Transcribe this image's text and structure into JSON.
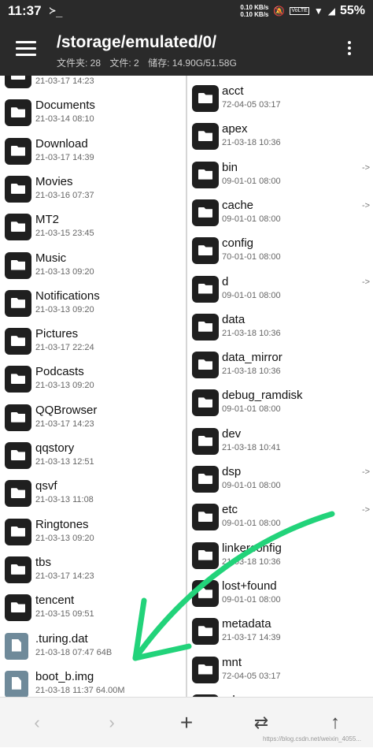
{
  "status": {
    "time": "11:37",
    "term": "≻_",
    "net_up": "0.10 KB/s",
    "net_down": "0.10 KB/s",
    "volte": "VoLTE",
    "battery": "55%"
  },
  "header": {
    "path": "/storage/emulated/0/",
    "folders_label": "文件夹: 28",
    "files_label": "文件: 2",
    "storage_label": "储存: 14.90G/51.58G"
  },
  "left_pane": {
    "items": [
      {
        "name": "",
        "meta": "21-03-17 14:23",
        "type": "folder"
      },
      {
        "name": "Documents",
        "meta": "21-03-14 08:10",
        "type": "folder"
      },
      {
        "name": "Download",
        "meta": "21-03-17 14:39",
        "type": "folder"
      },
      {
        "name": "Movies",
        "meta": "21-03-16 07:37",
        "type": "folder"
      },
      {
        "name": "MT2",
        "meta": "21-03-15 23:45",
        "type": "folder"
      },
      {
        "name": "Music",
        "meta": "21-03-13 09:20",
        "type": "folder"
      },
      {
        "name": "Notifications",
        "meta": "21-03-13 09:20",
        "type": "folder"
      },
      {
        "name": "Pictures",
        "meta": "21-03-17 22:24",
        "type": "folder"
      },
      {
        "name": "Podcasts",
        "meta": "21-03-13 09:20",
        "type": "folder"
      },
      {
        "name": "QQBrowser",
        "meta": "21-03-17 14:23",
        "type": "folder"
      },
      {
        "name": "qqstory",
        "meta": "21-03-13 12:51",
        "type": "folder"
      },
      {
        "name": "qsvf",
        "meta": "21-03-13 11:08",
        "type": "folder"
      },
      {
        "name": "Ringtones",
        "meta": "21-03-13 09:20",
        "type": "folder"
      },
      {
        "name": "tbs",
        "meta": "21-03-17 14:23",
        "type": "folder"
      },
      {
        "name": "tencent",
        "meta": "21-03-15 09:51",
        "type": "folder"
      },
      {
        "name": ".turing.dat",
        "meta": "21-03-18 07:47  64B",
        "type": "file"
      },
      {
        "name": "boot_b.img",
        "meta": "21-03-18 11:37  64.00M",
        "type": "file"
      }
    ]
  },
  "right_pane": {
    "items": [
      {
        "name": "acct",
        "meta": "72-04-05 03:17",
        "link": ""
      },
      {
        "name": "apex",
        "meta": "21-03-18 10:36",
        "link": ""
      },
      {
        "name": "bin",
        "meta": "09-01-01 08:00",
        "link": "->"
      },
      {
        "name": "cache",
        "meta": "09-01-01 08:00",
        "link": "->"
      },
      {
        "name": "config",
        "meta": "70-01-01 08:00",
        "link": ""
      },
      {
        "name": "d",
        "meta": "09-01-01 08:00",
        "link": "->"
      },
      {
        "name": "data",
        "meta": "21-03-18 10:36",
        "link": ""
      },
      {
        "name": "data_mirror",
        "meta": "21-03-18 10:36",
        "link": ""
      },
      {
        "name": "debug_ramdisk",
        "meta": "09-01-01 08:00",
        "link": ""
      },
      {
        "name": "dev",
        "meta": "21-03-18 10:41",
        "link": ""
      },
      {
        "name": "dsp",
        "meta": "09-01-01 08:00",
        "link": "->"
      },
      {
        "name": "etc",
        "meta": "09-01-01 08:00",
        "link": "->"
      },
      {
        "name": "linkerconfig",
        "meta": "21-03-18 10:36",
        "link": ""
      },
      {
        "name": "lost+found",
        "meta": "09-01-01 08:00",
        "link": ""
      },
      {
        "name": "metadata",
        "meta": "21-03-17 14:39",
        "link": ""
      },
      {
        "name": "mnt",
        "meta": "72-04-05 03:17",
        "link": ""
      },
      {
        "name": "odm",
        "meta": "",
        "link": ""
      }
    ]
  },
  "toolbar": {
    "back": "‹",
    "forward": "›",
    "add": "+",
    "swap": "⇄",
    "up": "↑"
  },
  "watermark": "https://blog.csdn.net/weixin_4055...",
  "colors": {
    "appbar": "#2a2a2a",
    "folder_icon": "#1f1f1f",
    "file_icon": "#6f8a9a",
    "annotation_arrow": "#22d37a"
  }
}
